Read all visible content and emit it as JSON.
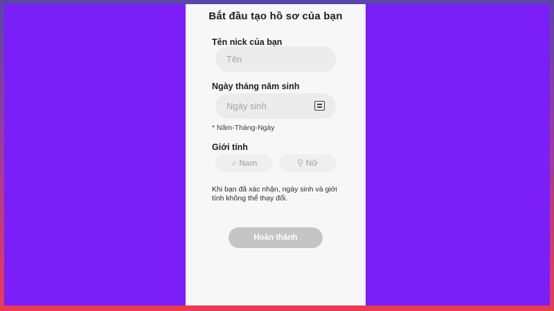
{
  "colors": {
    "outer_gradient_top": "#5a45a8",
    "outer_gradient_bottom": "#e93b55",
    "canvas_purple": "#7a1ff7",
    "panel_bg": "#f7f7f7",
    "input_bg": "#ececec",
    "button_disabled": "#c5c5c5"
  },
  "screen": {
    "title": "Bắt đầu tạo hồ sơ của bạn",
    "nickname": {
      "label": "Tên nick của bạn",
      "placeholder": "Tên"
    },
    "birthdate": {
      "label": "Ngày tháng năm sinh",
      "placeholder": "Ngày sinh",
      "icon": "calendar-icon",
      "hint": "* Năm-Tháng-Ngày"
    },
    "gender": {
      "label": "Giới tính",
      "options": [
        {
          "icon": "male-icon",
          "symbol": "♂",
          "label": "Nam"
        },
        {
          "icon": "female-icon",
          "symbol": "⚲",
          "label": "Nữ"
        }
      ]
    },
    "notice": "Khi bạn đã xác nhận, ngày sinh và giới tính không thể thay đổi.",
    "finish_button": "Hoàn thành"
  }
}
